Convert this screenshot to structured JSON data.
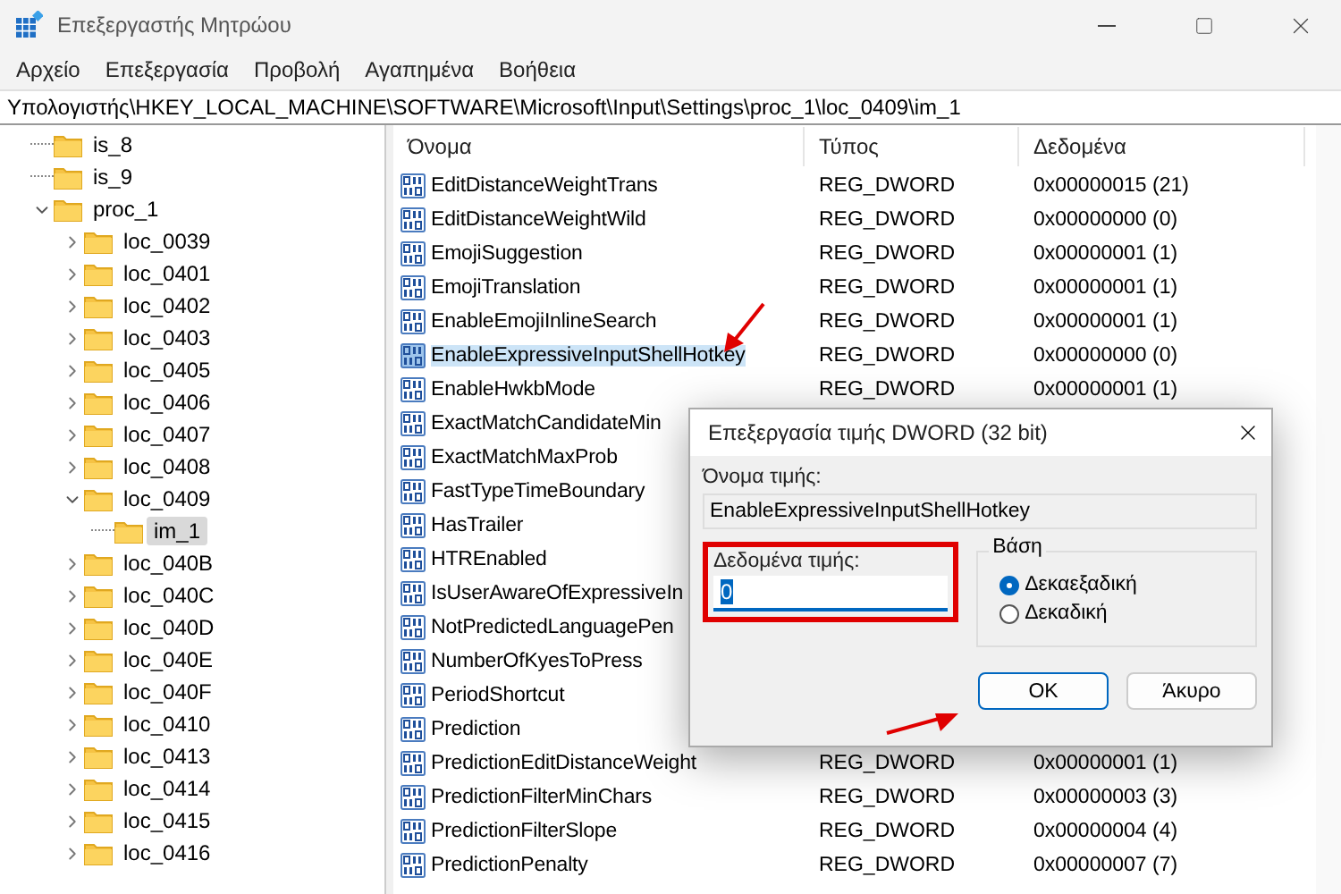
{
  "window": {
    "title": "Επεξεργαστής Μητρώου"
  },
  "menu": [
    "Αρχείο",
    "Επεξεργασία",
    "Προβολή",
    "Αγαπημένα",
    "Βοήθεια"
  ],
  "address": "Υπολογιστής\\HKEY_LOCAL_MACHINE\\SOFTWARE\\Microsoft\\Input\\Settings\\proc_1\\loc_0409\\im_1",
  "tree": [
    {
      "label": "is_8",
      "kind": "leaf",
      "selected": false
    },
    {
      "label": "is_9",
      "kind": "leaf",
      "selected": false
    },
    {
      "label": "proc_1",
      "kind": "node",
      "expanded": true,
      "selected": false,
      "children": [
        {
          "label": "loc_0039",
          "kind": "node",
          "expanded": false,
          "selected": false
        },
        {
          "label": "loc_0401",
          "kind": "node",
          "expanded": false,
          "selected": false
        },
        {
          "label": "loc_0402",
          "kind": "node",
          "expanded": false,
          "selected": false
        },
        {
          "label": "loc_0403",
          "kind": "node",
          "expanded": false,
          "selected": false
        },
        {
          "label": "loc_0405",
          "kind": "node",
          "expanded": false,
          "selected": false
        },
        {
          "label": "loc_0406",
          "kind": "node",
          "expanded": false,
          "selected": false
        },
        {
          "label": "loc_0407",
          "kind": "node",
          "expanded": false,
          "selected": false
        },
        {
          "label": "loc_0408",
          "kind": "node",
          "expanded": false,
          "selected": false
        },
        {
          "label": "loc_0409",
          "kind": "node",
          "expanded": true,
          "selected": false,
          "children": [
            {
              "label": "im_1",
              "kind": "leaf",
              "selected": true
            }
          ]
        },
        {
          "label": "loc_040B",
          "kind": "node",
          "expanded": false,
          "selected": false
        },
        {
          "label": "loc_040C",
          "kind": "node",
          "expanded": false,
          "selected": false
        },
        {
          "label": "loc_040D",
          "kind": "node",
          "expanded": false,
          "selected": false
        },
        {
          "label": "loc_040E",
          "kind": "node",
          "expanded": false,
          "selected": false
        },
        {
          "label": "loc_040F",
          "kind": "node",
          "expanded": false,
          "selected": false
        },
        {
          "label": "loc_0410",
          "kind": "node",
          "expanded": false,
          "selected": false
        },
        {
          "label": "loc_0413",
          "kind": "node",
          "expanded": false,
          "selected": false
        },
        {
          "label": "loc_0414",
          "kind": "node",
          "expanded": false,
          "selected": false
        },
        {
          "label": "loc_0415",
          "kind": "node",
          "expanded": false,
          "selected": false
        },
        {
          "label": "loc_0416",
          "kind": "node",
          "expanded": false,
          "selected": false
        }
      ]
    }
  ],
  "list": {
    "columns": [
      "Όνομα",
      "Τύπος",
      "Δεδομένα"
    ],
    "rows": [
      {
        "name": "EditDistanceWeightTrans",
        "type": "REG_DWORD",
        "data": "0x00000015 (21)",
        "selected": false
      },
      {
        "name": "EditDistanceWeightWild",
        "type": "REG_DWORD",
        "data": "0x00000000 (0)",
        "selected": false
      },
      {
        "name": "EmojiSuggestion",
        "type": "REG_DWORD",
        "data": "0x00000001 (1)",
        "selected": false
      },
      {
        "name": "EmojiTranslation",
        "type": "REG_DWORD",
        "data": "0x00000001 (1)",
        "selected": false
      },
      {
        "name": "EnableEmojiInlineSearch",
        "type": "REG_DWORD",
        "data": "0x00000001 (1)",
        "selected": false
      },
      {
        "name": "EnableExpressiveInputShellHotkey",
        "type": "REG_DWORD",
        "data": "0x00000000 (0)",
        "selected": true
      },
      {
        "name": "EnableHwkbMode",
        "type": "REG_DWORD",
        "data": "0x00000001 (1)",
        "selected": false
      },
      {
        "name": "ExactMatchCandidateMin",
        "selected": false
      },
      {
        "name": "ExactMatchMaxProb",
        "selected": false
      },
      {
        "name": "FastTypeTimeBoundary",
        "selected": false
      },
      {
        "name": "HasTrailer",
        "selected": false
      },
      {
        "name": "HTREnabled",
        "selected": false
      },
      {
        "name": "IsUserAwareOfExpressiveIn",
        "selected": false
      },
      {
        "name": "NotPredictedLanguagePen",
        "selected": false
      },
      {
        "name": "NumberOfKyesToPress",
        "selected": false
      },
      {
        "name": "PeriodShortcut",
        "selected": false
      },
      {
        "name": "Prediction",
        "selected": false
      },
      {
        "name": "PredictionEditDistanceWeight",
        "type": "REG_DWORD",
        "data": "0x00000001 (1)",
        "selected": false
      },
      {
        "name": "PredictionFilterMinChars",
        "type": "REG_DWORD",
        "data": "0x00000003 (3)",
        "selected": false
      },
      {
        "name": "PredictionFilterSlope",
        "type": "REG_DWORD",
        "data": "0x00000004 (4)",
        "selected": false
      },
      {
        "name": "PredictionPenalty",
        "type": "REG_DWORD",
        "data": "0x00000007 (7)",
        "selected": false
      }
    ]
  },
  "dialog": {
    "title": "Επεξεργασία τιμής DWORD (32 bit)",
    "name_label": "Όνομα τιμής:",
    "name_value": "EnableExpressiveInputShellHotkey",
    "data_label": "Δεδομένα τιμής:",
    "data_value": "0",
    "base_label": "Βάση",
    "bases": [
      {
        "label": "Δεκαεξαδική",
        "selected": true
      },
      {
        "label": "Δεκαδική",
        "selected": false
      }
    ],
    "buttons": [
      {
        "label": "OK",
        "kind": "default"
      },
      {
        "label": "Άκυρο",
        "kind": "normal"
      }
    ]
  }
}
